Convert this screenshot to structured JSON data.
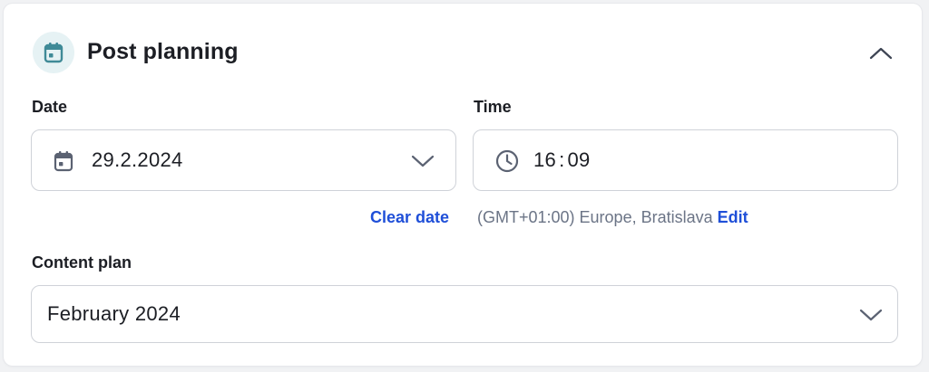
{
  "panel": {
    "title": "Post planning",
    "header_icon": "calendar-icon",
    "collapse_icon": "chevron-up-icon"
  },
  "date_field": {
    "label": "Date",
    "value": "29.2.2024",
    "icon": "calendar-icon",
    "dropdown_icon": "chevron-down-icon",
    "clear_label": "Clear date"
  },
  "time_field": {
    "label": "Time",
    "hours": "16",
    "separator": ":",
    "minutes": "09",
    "icon": "clock-icon",
    "timezone": "(GMT+01:00) Europe, Bratislava",
    "edit_label": "Edit"
  },
  "content_plan": {
    "label": "Content plan",
    "value": "February 2024",
    "dropdown_icon": "chevron-down-icon"
  },
  "colors": {
    "accent_link": "#1f4fd8",
    "header_icon_bg": "#e6f2f4",
    "header_icon_fg": "#3f8a97",
    "text_primary": "#1c1e24",
    "text_muted": "#6b7486",
    "border": "#cfd2d8"
  }
}
